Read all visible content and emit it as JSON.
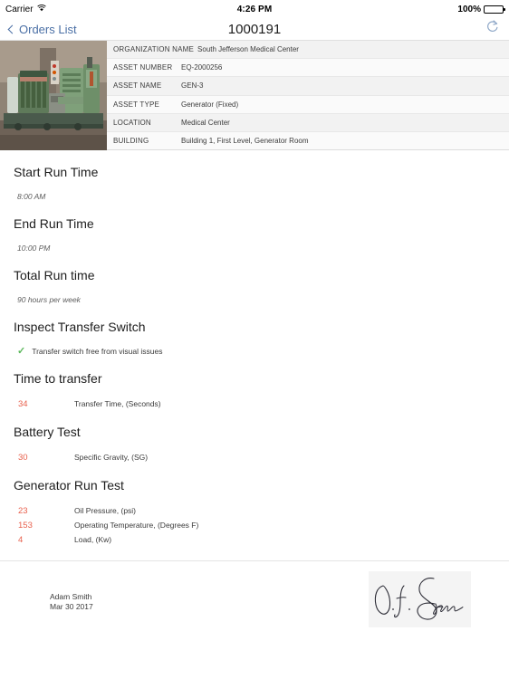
{
  "status_bar": {
    "carrier": "Carrier",
    "wifi_icon": "wifi-icon",
    "time": "4:26 PM",
    "battery_percent": "100%",
    "battery_icon": "battery-full-icon"
  },
  "nav_bar": {
    "back_label": "Orders List",
    "back_icon": "chevron-left-icon",
    "title": "1000191",
    "refresh_icon": "refresh-icon"
  },
  "asset": {
    "photo_alt": "generator-photo",
    "rows": [
      {
        "label": "ORGANIZATION NAME",
        "value": "South Jefferson Medical Center"
      },
      {
        "label": "ASSET NUMBER",
        "value": "EQ-2000256"
      },
      {
        "label": "ASSET NAME",
        "value": "GEN-3"
      },
      {
        "label": "ASSET TYPE",
        "value": "Generator (Fixed)"
      },
      {
        "label": "LOCATION",
        "value": "Medical Center"
      },
      {
        "label": "BUILDING",
        "value": "Building 1, First Level, Generator Room"
      }
    ]
  },
  "sections": {
    "start_run_time": {
      "title": "Start Run Time",
      "value": "8:00 AM"
    },
    "end_run_time": {
      "title": "End Run Time",
      "value": "10:00 PM"
    },
    "total_run_time": {
      "title": "Total Run time",
      "value": "90 hours per week"
    },
    "inspect_transfer_switch": {
      "title": "Inspect Transfer Switch",
      "check_icon": "checkmark-icon",
      "check_label": "Transfer switch free from visual issues"
    },
    "time_to_transfer": {
      "title": "Time to transfer",
      "items": [
        {
          "value": "34",
          "label": "Transfer Time, (Seconds)"
        }
      ]
    },
    "battery_test": {
      "title": "Battery Test",
      "items": [
        {
          "value": "30",
          "label": "Specific Gravity, (SG)"
        }
      ]
    },
    "generator_run_test": {
      "title": "Generator Run Test",
      "items": [
        {
          "value": "23",
          "label": "Oil Pressure, (psi)"
        },
        {
          "value": "153",
          "label": "Operating Temperature, (Degrees F)"
        },
        {
          "value": "4",
          "label": "Load, (Kw)"
        }
      ]
    }
  },
  "signature": {
    "signer_name": "Adam Smith",
    "signed_date": "Mar 30 2017",
    "signature_alt": "handwritten-signature"
  },
  "colors": {
    "accent_link": "#4a6fa5",
    "value_red": "#e8604d",
    "check_green": "#5cb85c"
  }
}
